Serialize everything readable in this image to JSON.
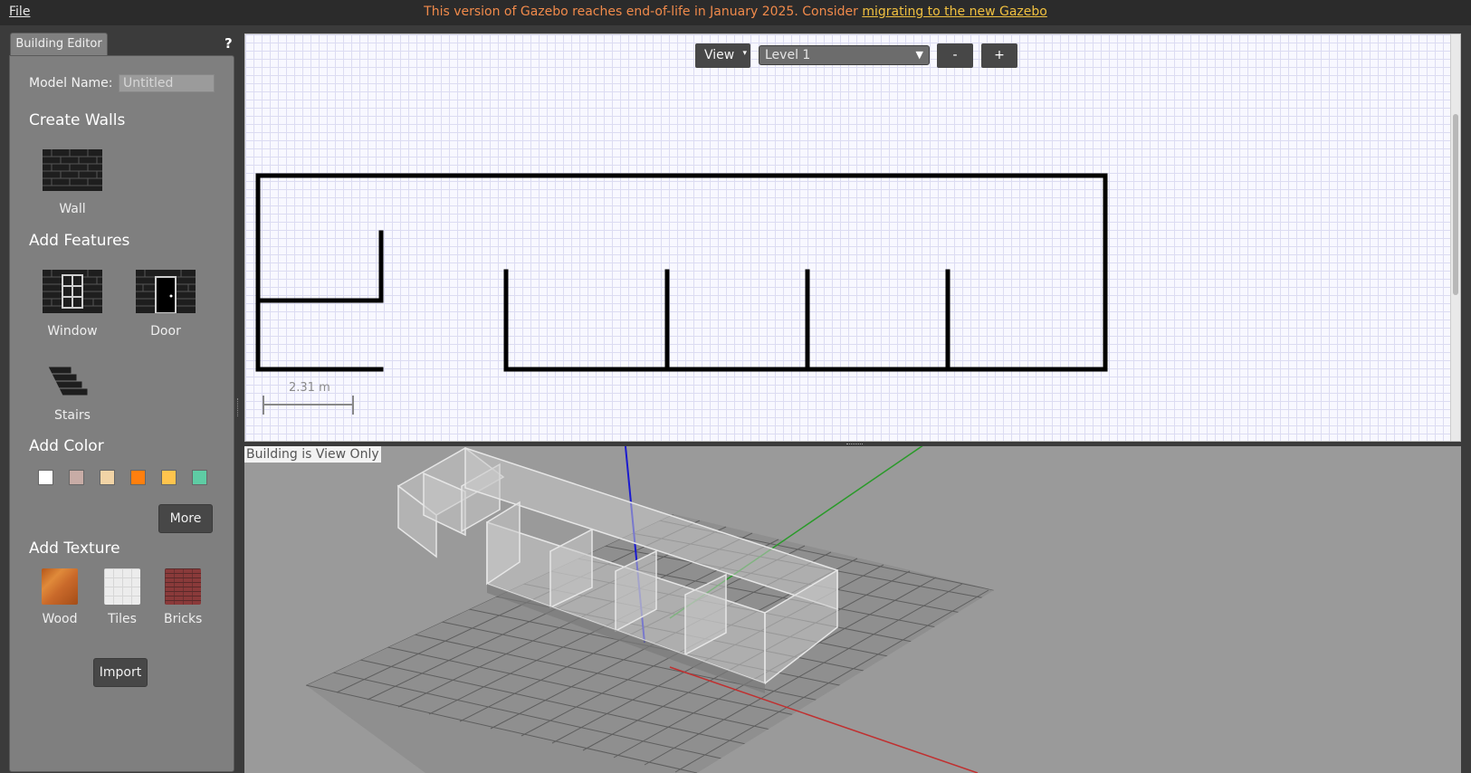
{
  "menu": {
    "file": "File"
  },
  "banner": {
    "text": "This version of Gazebo reaches end-of-life in January 2025. Consider ",
    "link": "migrating to the new Gazebo"
  },
  "left_panel": {
    "tab_label": "Building Editor",
    "help": "?",
    "model_name_label": "Model Name:",
    "model_name_value": "Untitled",
    "create_walls_title": "Create Walls",
    "wall_label": "Wall",
    "add_features_title": "Add Features",
    "window_label": "Window",
    "door_label": "Door",
    "stairs_label": "Stairs",
    "add_color_title": "Add Color",
    "colors": [
      "#ffffff",
      "#c8aca6",
      "#f2d4a6",
      "#ff7f0e",
      "#ffc44d",
      "#5ecca4"
    ],
    "more_label": "More",
    "add_texture_title": "Add Texture",
    "textures": [
      "Wood",
      "Tiles",
      "Bricks"
    ],
    "import_label": "Import"
  },
  "editor2d": {
    "view_label": "View",
    "level_value": "Level 1",
    "minus_label": "-",
    "plus_label": "+",
    "scale_label": "2.31 m"
  },
  "view3d": {
    "status": "Building is View Only"
  }
}
